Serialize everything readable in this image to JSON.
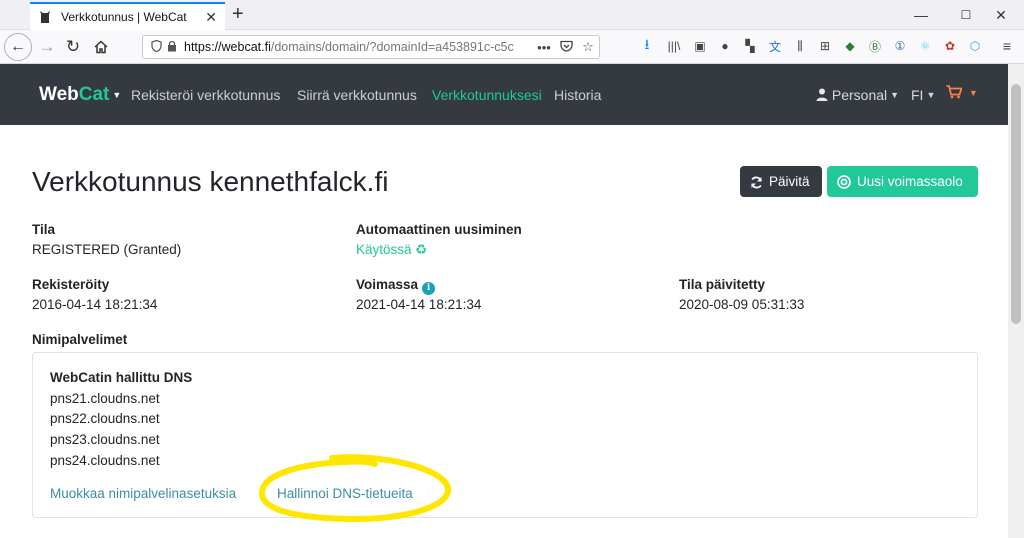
{
  "browser": {
    "tab_title": "Verkkotunnus | WebCat",
    "url_host": "https://webcat.fi",
    "url_path": "/domains/domain/?domainId=a453891c-c5c",
    "win_min": "—",
    "win_max": "☐",
    "win_close": "✕"
  },
  "site": {
    "brand_main": "Web",
    "brand_accent": "Cat",
    "nav": [
      "Rekisteröi verkkotunnus",
      "Siirrä verkkotunnus",
      "Verkkotunnuksesi",
      "Historia"
    ],
    "active_nav_index": 2,
    "account": "Personal",
    "language": "FI"
  },
  "domain": {
    "title": "Verkkotunnus kennethfalck.fi",
    "refresh_button": "Päivitä",
    "renew_button": "Uusi voimassaolo",
    "status_label": "Tila",
    "status_value": "REGISTERED (Granted)",
    "autorenew_label": "Automaattinen uusiminen",
    "autorenew_value": "Käytössä",
    "registered_label": "Rekisteröity",
    "registered_value": "2016-04-14 18:21:34",
    "valid_label": "Voimassa",
    "valid_value": "2021-04-14 18:21:34",
    "updated_label": "Tila päivitetty",
    "updated_value": "2020-08-09 05:31:33",
    "nameservers_label": "Nimipalvelimet"
  },
  "nameservers": {
    "title": "WebCatin hallittu DNS",
    "servers": [
      "pns21.cloudns.net",
      "pns22.cloudns.net",
      "pns23.cloudns.net",
      "pns24.cloudns.net"
    ],
    "edit_link": "Muokkaa nimipalvelinasetuksia",
    "manage_link": "Hallinnoi DNS-tietueita"
  },
  "colors": {
    "accent": "#20c997",
    "navbar": "#343a40",
    "annotation": "#ffe600"
  }
}
